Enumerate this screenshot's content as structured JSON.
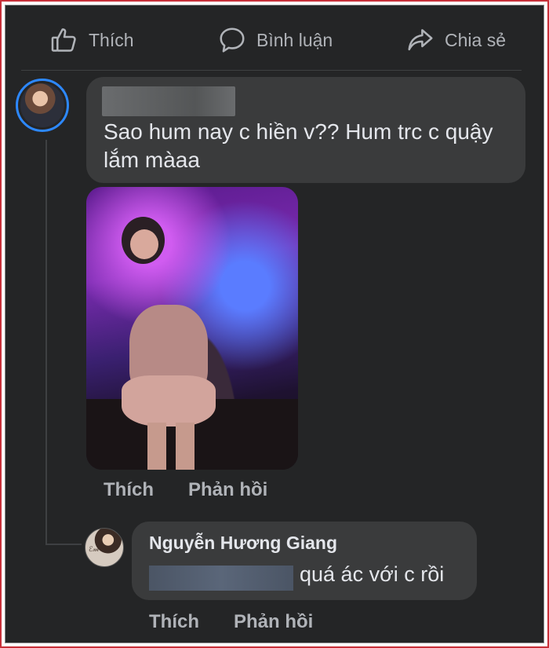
{
  "actions": {
    "like_label": "Thích",
    "comment_label": "Bình luận",
    "share_label": "Chia sẻ"
  },
  "comment": {
    "text": "Sao hum nay c hiền v?? Hum trc c quậy lắm màaa",
    "like_label": "Thích",
    "reply_label": "Phản hồi"
  },
  "reply": {
    "author": "Nguyễn Hương Giang",
    "text": "quá ác với c rồi",
    "like_label": "Thích",
    "reply_label": "Phản hồi"
  },
  "colors": {
    "background": "#242526",
    "bubble": "#3a3b3c",
    "muted_text": "#b0b3b8",
    "primary_text": "#e4e6eb",
    "avatar_ring": "#2d88ff",
    "frame": "#c8313a"
  }
}
